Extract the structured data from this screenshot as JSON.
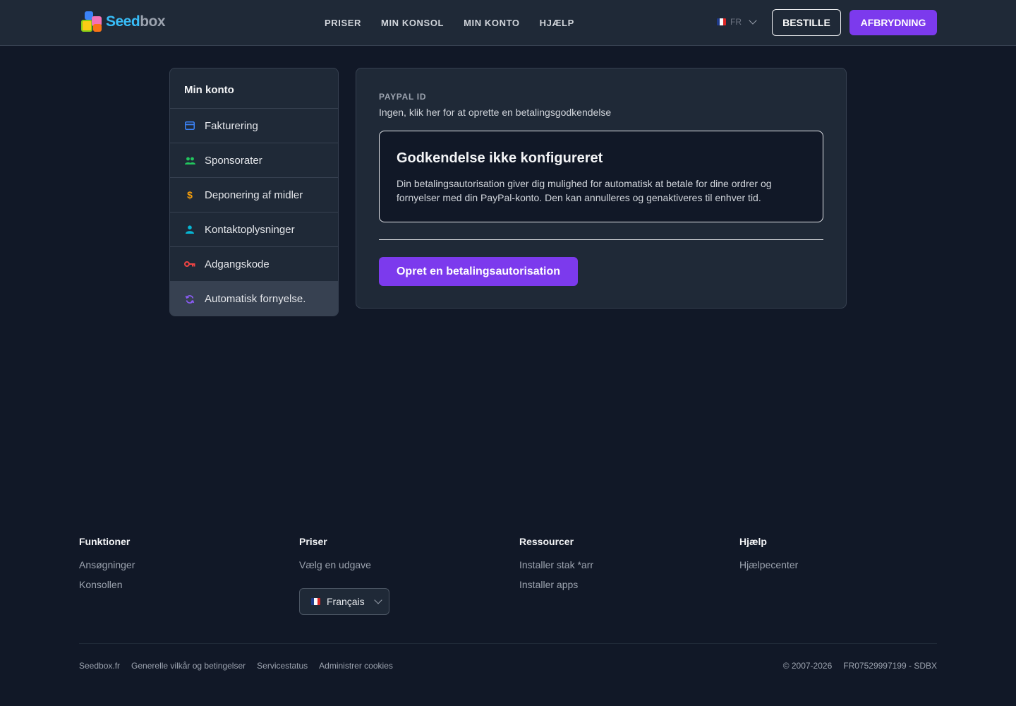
{
  "header": {
    "logo": {
      "part1": "Seed",
      "part2": "box"
    },
    "nav": [
      "PRISER",
      "MIN KONSOL",
      "MIN KONTO",
      "HJÆLP"
    ],
    "lang_code": "FR",
    "order_label": "BESTILLE",
    "logout_label": "AFBRYDNING"
  },
  "sidebar": {
    "title": "Min konto",
    "items": [
      {
        "label": "Fakturering",
        "icon": "credit-card-icon",
        "color": "#3b82f6"
      },
      {
        "label": "Sponsorater",
        "icon": "users-icon",
        "color": "#22c55e"
      },
      {
        "label": "Deponering af midler",
        "icon": "dollar-icon",
        "color": "#f59e0b"
      },
      {
        "label": "Kontaktoplysninger",
        "icon": "user-icon",
        "color": "#06b6d4"
      },
      {
        "label": "Adgangskode",
        "icon": "key-icon",
        "color": "#ef4444"
      },
      {
        "label": "Automatisk fornyelse.",
        "icon": "refresh-icon",
        "color": "#8b5cf6",
        "active": true
      }
    ]
  },
  "main": {
    "paypal_label": "PAYPAL ID",
    "paypal_value": "Ingen, klik her for at oprette en betalingsgodkendelse",
    "notice_title": "Godkendelse ikke konfigureret",
    "notice_text": "Din betalingsautorisation giver dig mulighed for automatisk at betale for dine ordrer og fornyelser med din PayPal-konto. Den kan annulleres og genaktiveres til enhver tid.",
    "create_button": "Opret en betalingsautorisation"
  },
  "footer": {
    "columns": [
      {
        "title": "Funktioner",
        "links": [
          "Ansøgninger",
          "Konsollen"
        ]
      },
      {
        "title": "Priser",
        "links": [
          "Vælg en udgave"
        ]
      },
      {
        "title": "Ressourcer",
        "links": [
          "Installer stak *arr",
          "Installer apps"
        ]
      },
      {
        "title": "Hjælp",
        "links": [
          "Hjælpecenter"
        ]
      }
    ],
    "language_select": "Français",
    "bottom_links": [
      "Seedbox.fr",
      "Generelle vilkår og betingelser",
      "Servicestatus",
      "Administrer cookies"
    ],
    "copyright": "© 2007-2026",
    "company_id": "FR07529997199 - SDBX"
  },
  "colors": {
    "accent": "#7c3aed",
    "background": "#111827",
    "surface": "#1f2937"
  }
}
